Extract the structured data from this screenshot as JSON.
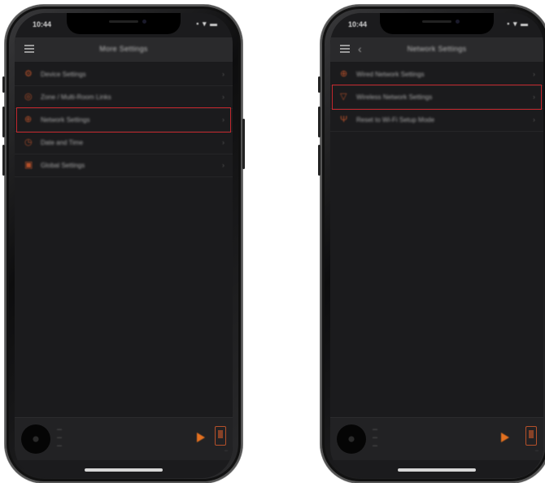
{
  "colors": {
    "accent": "#e3701f",
    "highlight_box": "#c1272d",
    "screen_bg": "#1b1b1d",
    "header_bg": "#2a2a2c"
  },
  "left_phone": {
    "status": {
      "time": "10:44",
      "icons": "▪ ▾ ▬"
    },
    "header": {
      "title": "More Settings",
      "menu_icon": "hamburger-icon"
    },
    "items": [
      {
        "label": "Device Settings",
        "icon": "gear-icon",
        "glyph": "⚙"
      },
      {
        "label": "Zone / Multi-Room Links",
        "icon": "zone-icon",
        "glyph": "◎"
      },
      {
        "label": "Network Settings",
        "icon": "network-icon",
        "glyph": "⊕",
        "highlighted": true
      },
      {
        "label": "Date and Time",
        "icon": "clock-icon",
        "glyph": "◷"
      },
      {
        "label": "Global Settings",
        "icon": "global-icon",
        "glyph": "▣"
      }
    ],
    "player": {
      "line1": "—",
      "line2": "—",
      "line3": "—",
      "device_label": "—"
    }
  },
  "right_phone": {
    "status": {
      "time": "10:44",
      "icons": "▪ ▾ ▬"
    },
    "header": {
      "title": "Network Settings",
      "menu_icon": "hamburger-icon",
      "back_icon": "chevron-left-icon",
      "back_glyph": "‹"
    },
    "items": [
      {
        "label": "Wired Network Settings",
        "icon": "ethernet-icon",
        "glyph": "⊕"
      },
      {
        "label": "Wireless Network Settings",
        "icon": "wifi-icon",
        "glyph": "▽",
        "highlighted": true
      },
      {
        "label": "Reset to Wi-Fi Setup Mode",
        "icon": "antenna-icon",
        "glyph": "Ψ"
      }
    ],
    "player": {
      "line1": "—",
      "line2": "—",
      "line3": "—",
      "device_label": "—"
    }
  },
  "chevron_glyph": "›"
}
